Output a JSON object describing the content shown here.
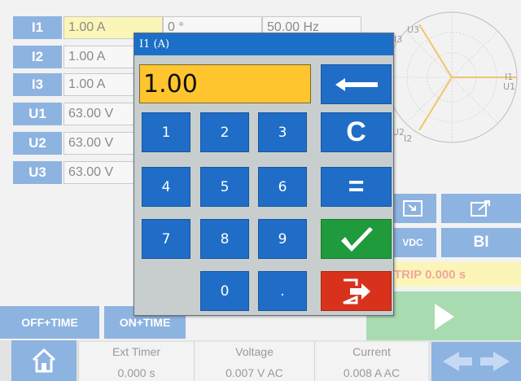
{
  "channels": [
    {
      "label": "I1",
      "values": [
        "1.00 A",
        "0 °",
        "50.00 Hz"
      ]
    },
    {
      "label": "I2",
      "values": [
        "1.00 A"
      ]
    },
    {
      "label": "I3",
      "values": [
        "1.00 A"
      ]
    },
    {
      "label": "U1",
      "values": [
        "63.00 V"
      ]
    },
    {
      "label": "U2",
      "values": [
        "63.00 V"
      ]
    },
    {
      "label": "U3",
      "values": [
        "63.00 V"
      ]
    }
  ],
  "phasor": {
    "labels": {
      "i3": "I3",
      "u3": "U3",
      "i1": "I1",
      "u1": "U1",
      "u2": "U2",
      "i2": "I2"
    }
  },
  "side_buttons": {
    "vdc": "VDC",
    "bi": "BI"
  },
  "trip_text": "TRIP 0.000 s",
  "mode_buttons": {
    "off_time": "OFF+TIME",
    "on_time": "ON+TIME"
  },
  "status": [
    {
      "title": "Ext Timer",
      "value": "0.000 s"
    },
    {
      "title": "Voltage",
      "value": "0.007 V AC"
    },
    {
      "title": "Current",
      "value": "0.008 A AC"
    }
  ],
  "dialog": {
    "title": "I1 (A)",
    "display_value": "1.00",
    "keys": {
      "k1": "1",
      "k2": "2",
      "k3": "3",
      "k4": "4",
      "k5": "5",
      "k6": "6",
      "k7": "7",
      "k8": "8",
      "k9": "9",
      "k0": "0",
      "dot": ".",
      "clear": "C",
      "equals": "="
    }
  },
  "colors": {
    "accent_blue": "#1f6dc7",
    "title_blue": "#1c6fc6",
    "display_amber": "#ffc52e",
    "ok_green": "#1f9a3c",
    "exit_red": "#d9321c"
  },
  "icons": {
    "backspace": "backspace-arrow-icon",
    "ok": "checkmark-icon",
    "exit": "exit-door-icon",
    "home": "home-icon",
    "play": "play-icon"
  }
}
